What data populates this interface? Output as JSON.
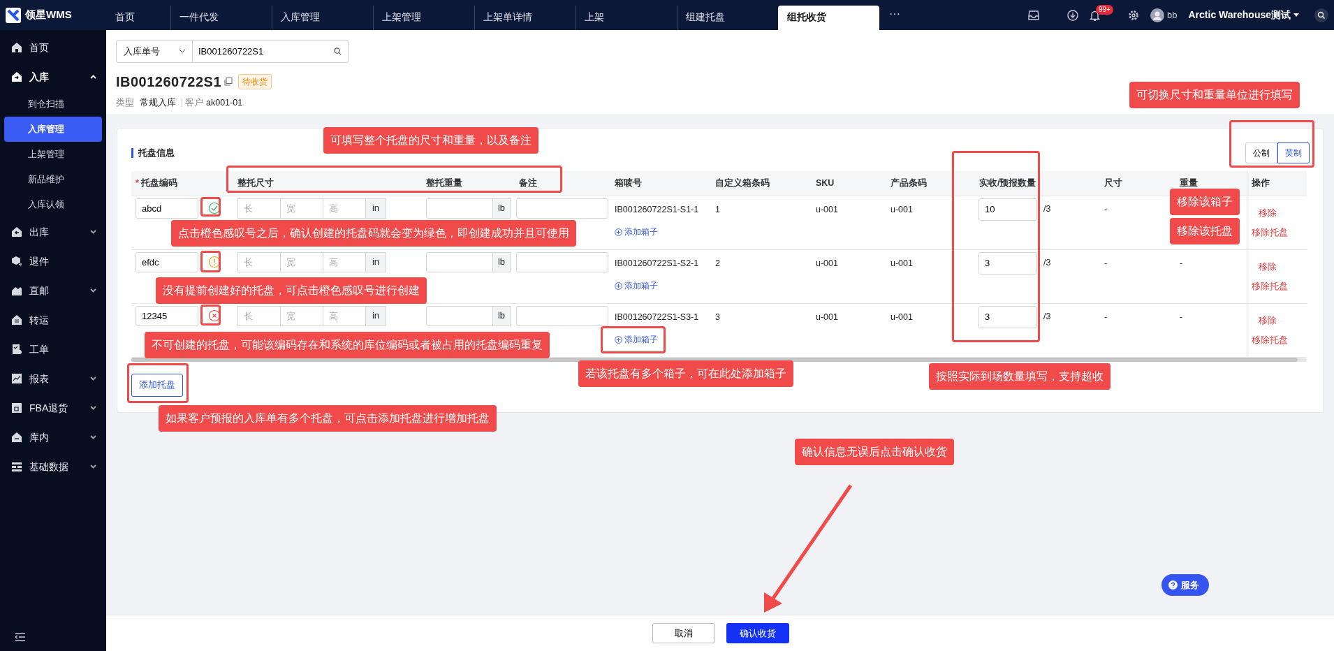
{
  "app": {
    "logo": "领星WMS"
  },
  "tabs": [
    {
      "label": "首页",
      "selected": false
    },
    {
      "label": "一件代发",
      "selected": false
    },
    {
      "label": "入库管理",
      "selected": false
    },
    {
      "label": "上架管理",
      "selected": false
    },
    {
      "label": "上架单详情",
      "selected": false
    },
    {
      "label": "上架",
      "selected": false
    },
    {
      "label": "组建托盘",
      "selected": false
    },
    {
      "label": "组托收货",
      "selected": true
    }
  ],
  "more_tabs": "···",
  "header": {
    "badge": "99+",
    "user": "bb",
    "warehouse": "Arctic Warehouse测试"
  },
  "sidebar": [
    {
      "label": "首页",
      "kind": "link"
    },
    {
      "label": "入库",
      "kind": "group",
      "expanded": true,
      "children": [
        {
          "label": "到仓扫描",
          "selected": false
        },
        {
          "label": "入库管理",
          "selected": true
        },
        {
          "label": "上架管理",
          "selected": false
        },
        {
          "label": "新品维护",
          "selected": false
        },
        {
          "label": "入库认领",
          "selected": false
        }
      ]
    },
    {
      "label": "出库",
      "kind": "group",
      "expanded": false
    },
    {
      "label": "退件",
      "kind": "link"
    },
    {
      "label": "直邮",
      "kind": "group",
      "expanded": false
    },
    {
      "label": "转运",
      "kind": "link"
    },
    {
      "label": "工单",
      "kind": "link"
    },
    {
      "label": "报表",
      "kind": "group",
      "expanded": false
    },
    {
      "label": "FBA退货",
      "kind": "group",
      "expanded": false
    },
    {
      "label": "库内",
      "kind": "group",
      "expanded": false
    },
    {
      "label": "基础数据",
      "kind": "group",
      "expanded": false
    }
  ],
  "search": {
    "field": "入库单号",
    "value": "IB001260722S1"
  },
  "order": {
    "number": "IB001260722S1",
    "status": "待收货",
    "type_label": "类型",
    "type": "常规入库",
    "customer_label": "客户",
    "customer": "ak001-01"
  },
  "pallet_section": {
    "title": "托盘信息",
    "units": [
      {
        "label": "公制",
        "selected": false
      },
      {
        "label": "英制",
        "selected": true
      }
    ],
    "columns": [
      {
        "label": "托盘编码",
        "required_mark": "*"
      },
      {
        "label": "整托尺寸"
      },
      {
        "label": "整托重量"
      },
      {
        "label": "备注"
      },
      {
        "label": "箱唛号"
      },
      {
        "label": "自定义箱条码"
      },
      {
        "label": "SKU"
      },
      {
        "label": "产品条码"
      },
      {
        "label": "实收/预报数量"
      },
      {
        "label": "尺寸"
      },
      {
        "label": "重量"
      },
      {
        "label": "操作"
      }
    ],
    "rows": [
      {
        "code": "abcd",
        "created": true,
        "creatable": true,
        "placeholders": [
          "长",
          "宽",
          "高"
        ],
        "length_unit": "in",
        "weight_unit": "lb",
        "box_no": "IB001260722S1-S1-1",
        "custom_code": "1",
        "sku": "u-001",
        "barcode": "u-001",
        "received": "10",
        "forecast": "/3",
        "size": "-",
        "remove": "移除",
        "remove_pallet": "移除托盘",
        "add_box": "添加箱子"
      },
      {
        "code": "efdc",
        "created": false,
        "creatable": true,
        "placeholders": [
          "长",
          "宽",
          "高"
        ],
        "length_unit": "in",
        "weight_unit": "lb",
        "box_no": "IB001260722S1-S2-1",
        "custom_code": "2",
        "sku": "u-001",
        "barcode": "u-001",
        "received": "3",
        "forecast": "/3",
        "size": "-",
        "weight": "-",
        "remove": "移除",
        "remove_pallet": "移除托盘",
        "add_box": "添加箱子"
      },
      {
        "code": "12345",
        "created": false,
        "creatable": false,
        "placeholders": [
          "长",
          "宽",
          "高"
        ],
        "length_unit": "in",
        "weight_unit": "lb",
        "box_no": "IB001260722S1-S3-1",
        "custom_code": "3",
        "sku": "u-001",
        "barcode": "u-001",
        "received": "3",
        "forecast": "/3",
        "size": "-",
        "weight": "-",
        "remove": "移除",
        "remove_pallet": "移除托盘",
        "add_box": "添加箱子"
      }
    ],
    "add_pallet": "添加托盘"
  },
  "service": "服务",
  "footer": {
    "cancel": "取消",
    "confirm": "确认收货"
  },
  "callouts": [
    {
      "text": "可切换尺寸和重量单位进行填写"
    },
    {
      "text": "可填写整个托盘的尺寸和重量，以及备注"
    },
    {
      "text": "点击橙色感叹号之后，确认创建的托盘码就会变为绿色，即创建成功并且可使用"
    },
    {
      "text": "没有提前创建好的托盘，可点击橙色感叹号进行创建"
    },
    {
      "text": "不可创建的托盘，可能该编码存在和系统的库位编码或者被占用的托盘编码重复"
    },
    {
      "text": "若该托盘有多个箱子，可在此处添加箱子"
    },
    {
      "text": "如果客户预报的入库单有多个托盘，可点击添加托盘进行增加托盘"
    },
    {
      "text": "按照实际到场数量填写，支持超收"
    },
    {
      "text": "移除该箱子"
    },
    {
      "text": "移除该托盘"
    },
    {
      "text": "确认信息无误后点击确认收货"
    }
  ]
}
